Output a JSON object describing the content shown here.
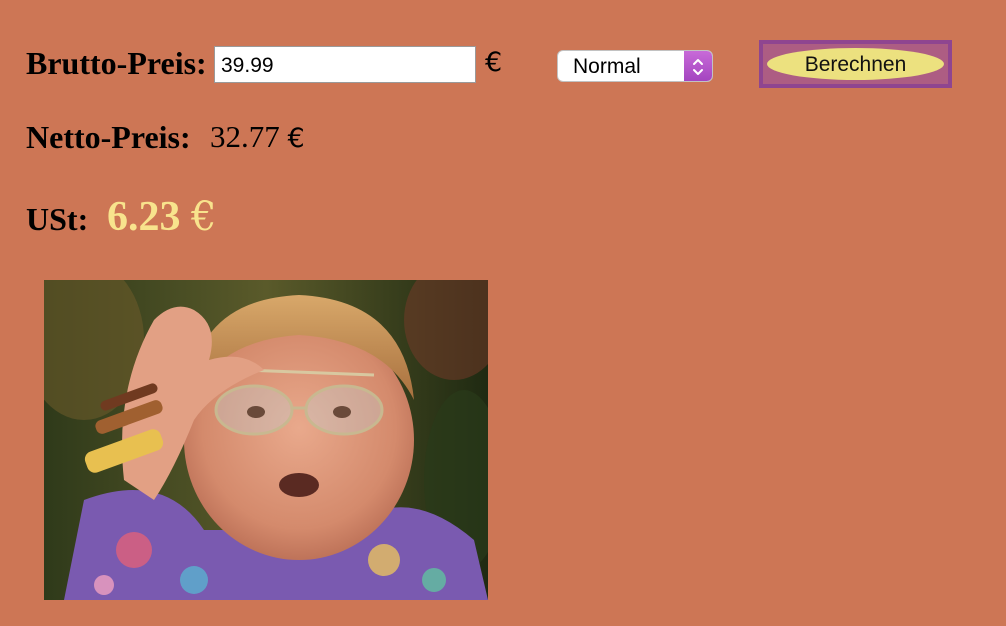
{
  "form": {
    "brutto_label": "Brutto-Preis:",
    "brutto_value": "39.99",
    "brutto_currency": "€",
    "tax_mode": {
      "selected": "Normal"
    },
    "calculate_button": "Berechnen"
  },
  "results": {
    "netto_label": "Netto-Preis:",
    "netto_value": "32.77",
    "netto_currency": "€",
    "ust_label": "USt:",
    "ust_value": "6.23",
    "ust_currency": "€"
  },
  "colors": {
    "background": "#cd7655",
    "ust_highlight": "#f8e38d",
    "button_face": "#ece17f",
    "button_border": "#8f4590",
    "select_accent": "#b756cc"
  },
  "image": {
    "subject": "reaction-gif-man-lowering-glasses"
  }
}
